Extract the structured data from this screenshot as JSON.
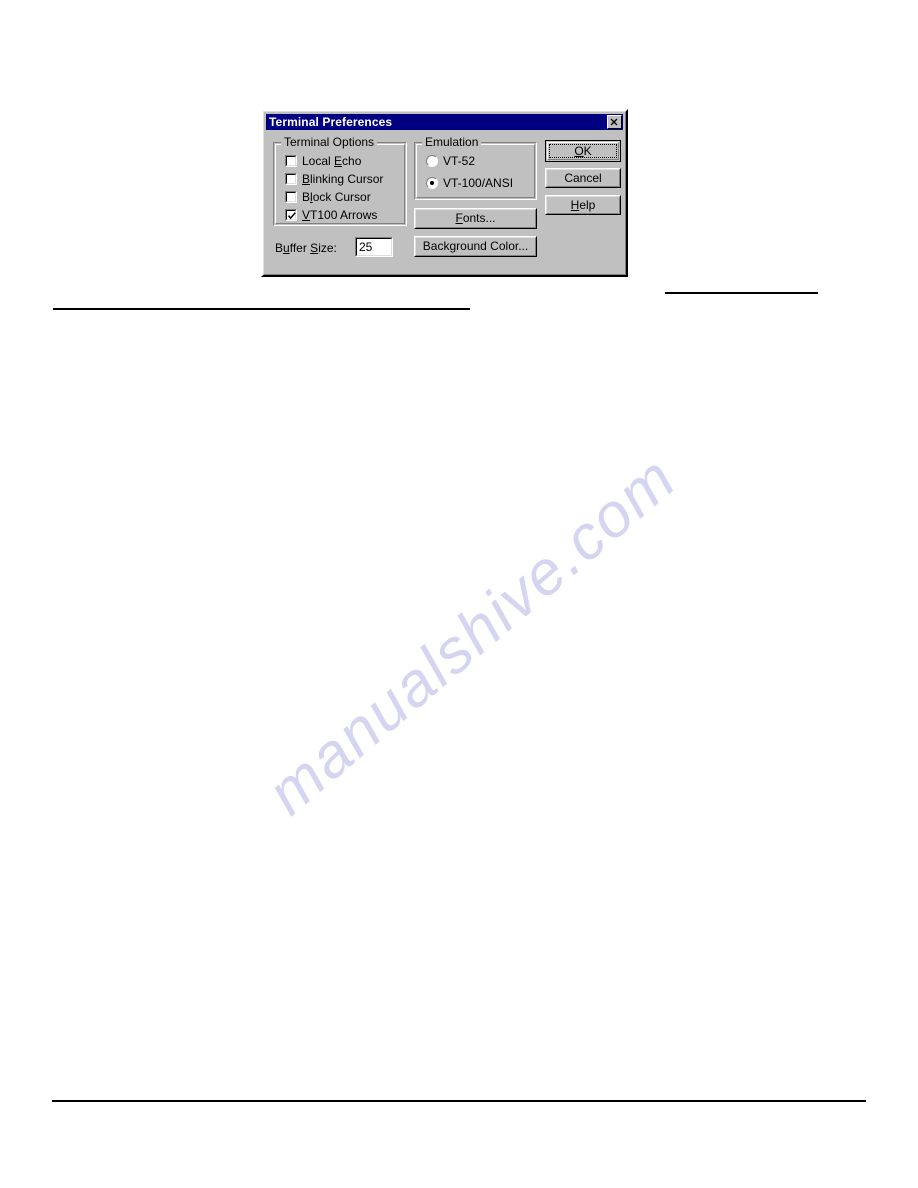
{
  "dialog": {
    "title": "Terminal Preferences",
    "close_icon": "close-x-icon",
    "groups": {
      "terminal_options": {
        "label": "Terminal Options",
        "checkboxes": [
          {
            "label_pre": "Local ",
            "accel": "E",
            "label_post": "cho",
            "checked": false
          },
          {
            "label_pre": "",
            "accel": "B",
            "label_post": "linking Cursor",
            "checked": false
          },
          {
            "label_pre": "B",
            "accel": "l",
            "label_post": "ock Cursor",
            "checked": false
          },
          {
            "label_pre": "",
            "accel": "V",
            "label_post": "T100 Arrows",
            "checked": true
          }
        ]
      },
      "emulation": {
        "label": "Emulation",
        "radios": [
          {
            "label": "VT-52",
            "selected": false
          },
          {
            "label": "VT-100/ANSI",
            "selected": true
          }
        ]
      }
    },
    "buffer_size": {
      "label_pre": "B",
      "accel1": "u",
      "label_mid": "ffer ",
      "accel2": "S",
      "label_post": "ize:",
      "value": "25"
    },
    "buttons": {
      "ok": {
        "label_pre": "",
        "accel": "O",
        "label_post": "K",
        "default": true
      },
      "cancel": {
        "label_pre": "Cancel",
        "accel": "",
        "label_post": ""
      },
      "help": {
        "label_pre": "",
        "accel": "H",
        "label_post": "elp"
      },
      "fonts": {
        "label_pre": "",
        "accel": "F",
        "label_post": "onts..."
      },
      "background_color": {
        "label_pre": "Back",
        "accel": "g",
        "label_post": "round Color..."
      }
    }
  },
  "page": {
    "watermark": "manualshive.com",
    "watermark_color": "#d5d5f2",
    "rules": 3
  },
  "colors": {
    "titlebar": "#000080",
    "dialog_face": "#c0c0c0",
    "title_text": "#ffffff",
    "field_bg": "#ffffff"
  }
}
